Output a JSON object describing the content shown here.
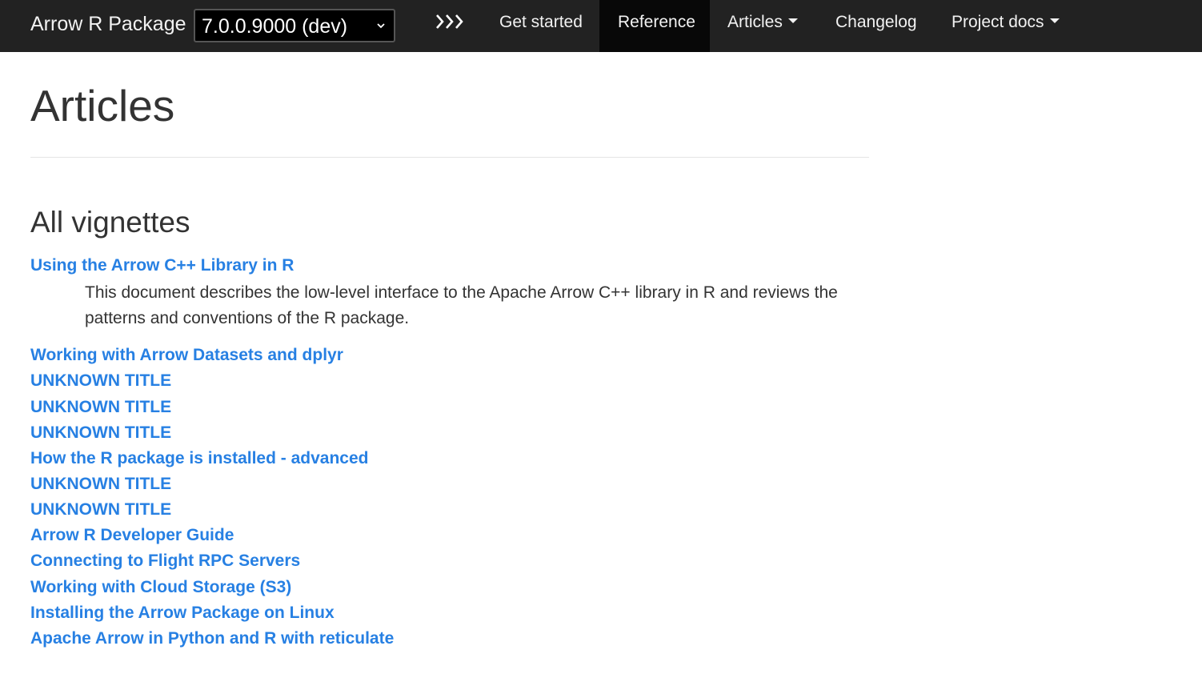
{
  "navbar": {
    "brand": "Arrow R Package",
    "version": "7.0.0.9000 (dev)",
    "items": [
      {
        "label": "Get started"
      },
      {
        "label": "Reference"
      },
      {
        "label": "Articles"
      },
      {
        "label": "Changelog"
      },
      {
        "label": "Project docs"
      }
    ],
    "active": "Reference"
  },
  "main": {
    "title": "Articles",
    "section_title": "All vignettes",
    "articles": [
      {
        "title": "Using the Arrow C++ Library in R",
        "description": "This document describes the low-level interface to the Apache Arrow C++ library in R and reviews the patterns and conventions of the R package."
      },
      {
        "title": "Working with Arrow Datasets and dplyr"
      },
      {
        "title": "UNKNOWN TITLE"
      },
      {
        "title": "UNKNOWN TITLE"
      },
      {
        "title": "UNKNOWN TITLE"
      },
      {
        "title": "How the R package is installed - advanced"
      },
      {
        "title": "UNKNOWN TITLE"
      },
      {
        "title": "UNKNOWN TITLE"
      },
      {
        "title": "Arrow R Developer Guide"
      },
      {
        "title": "Connecting to Flight RPC Servers"
      },
      {
        "title": "Working with Cloud Storage (S3)"
      },
      {
        "title": "Installing the Arrow Package on Linux"
      },
      {
        "title": "Apache Arrow in Python and R with reticulate"
      }
    ]
  },
  "colors": {
    "navbar_bg": "#222222",
    "link": "#2780e3",
    "text": "#333333"
  },
  "icons": {
    "version_dropdown": "chevron-down-icon",
    "nav_expand": "triple-chevron-right-icon",
    "menu_caret": "caret-down-icon"
  }
}
